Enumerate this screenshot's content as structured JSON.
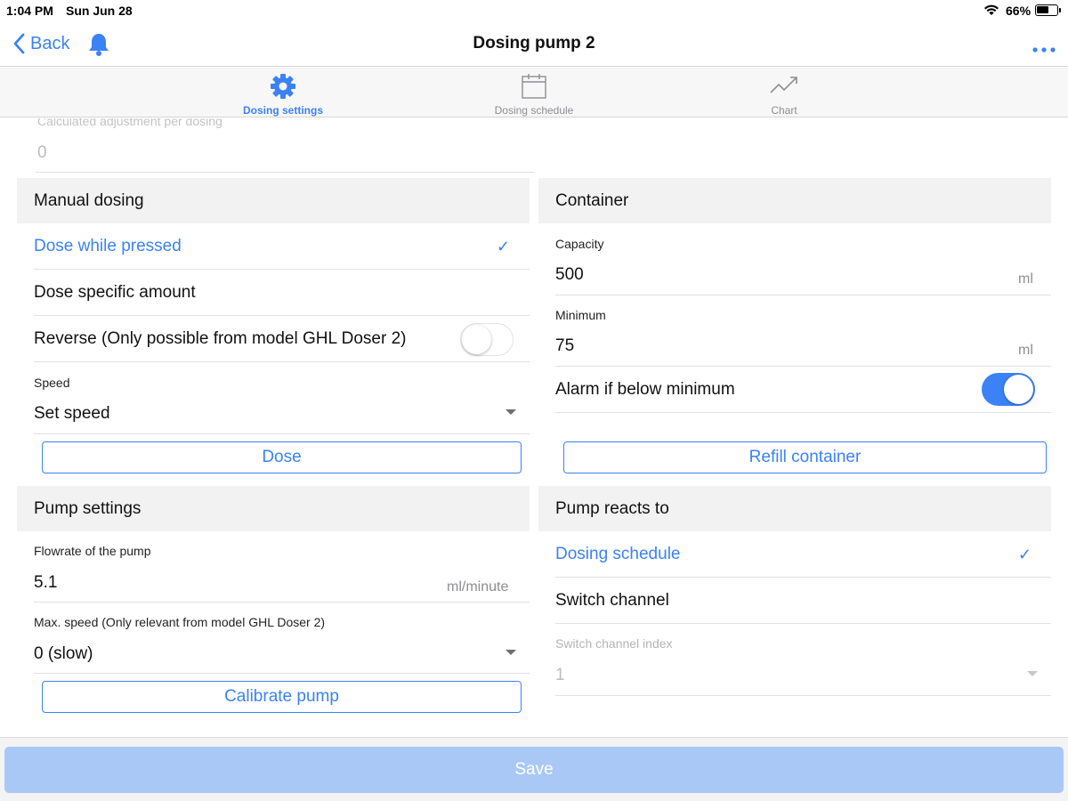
{
  "status_bar": {
    "time": "1:04 PM",
    "date": "Sun Jun 28",
    "battery": "66%",
    "battery_level": 0.66
  },
  "navbar": {
    "back_label": "Back",
    "title": "Dosing pump 2"
  },
  "tabs": [
    {
      "label": "Dosing settings",
      "icon": "gear-icon",
      "active": true
    },
    {
      "label": "Dosing schedule",
      "icon": "calendar-icon",
      "active": false
    },
    {
      "label": "Chart",
      "icon": "chart-icon",
      "active": false
    }
  ],
  "calculated": {
    "label": "Calculated adjustment per dosing",
    "value": "0"
  },
  "manual_dosing": {
    "title": "Manual dosing",
    "options": [
      {
        "label": "Dose while pressed",
        "selected": true
      },
      {
        "label": "Dose specific amount",
        "selected": false
      }
    ],
    "reverse_label": "Reverse (Only possible from model GHL Doser 2)",
    "reverse_on": false,
    "speed_label": "Speed",
    "speed_value": "Set speed",
    "dose_button": "Dose"
  },
  "pump_settings": {
    "title": "Pump settings",
    "flowrate_label": "Flowrate of the pump",
    "flowrate_value": "5.1",
    "flowrate_unit": "ml/minute",
    "max_speed_label": "Max. speed (Only relevant from model GHL Doser 2)",
    "max_speed_value": "0 (slow)",
    "calibrate_button": "Calibrate pump"
  },
  "container": {
    "title": "Container",
    "capacity_label": "Capacity",
    "capacity_value": "500",
    "capacity_unit": "ml",
    "minimum_label": "Minimum",
    "minimum_value": "75",
    "minimum_unit": "ml",
    "alarm_label": "Alarm if below minimum",
    "alarm_on": true,
    "refill_button": "Refill container"
  },
  "pump_reacts": {
    "title": "Pump reacts to",
    "options": [
      {
        "label": "Dosing schedule",
        "selected": true
      },
      {
        "label": "Switch channel",
        "selected": false
      }
    ],
    "switch_index_label": "Switch channel index",
    "switch_index_value": "1"
  },
  "footer": {
    "save_label": "Save"
  },
  "colors": {
    "accent": "#3b82f6",
    "save_disabled": "#a9c8f6",
    "section_bg": "#f2f2f2"
  }
}
